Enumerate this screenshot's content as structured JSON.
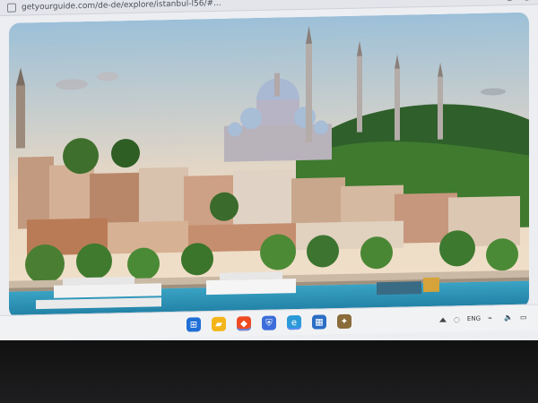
{
  "browser": {
    "url": "getyourguide.com/de-de/explore/istanbul-l56/#..."
  },
  "page": {
    "image_subject": "Istanbul skyline with Süleymaniye Mosque and Bosphorus ferries"
  },
  "taskbar": {
    "apps": [
      {
        "name": "windows-start-icon",
        "color": "#1f6fd6"
      },
      {
        "name": "file-explorer-icon",
        "color": "#f3b51a"
      },
      {
        "name": "brave-browser-icon",
        "color": "#f04a23"
      },
      {
        "name": "vpn-shield-icon",
        "color": "#3c6ddb"
      },
      {
        "name": "edge-icon",
        "color": "#2a9ad8"
      },
      {
        "name": "file-manager-icon",
        "color": "#2b6ec5"
      },
      {
        "name": "app-icon",
        "color": "#8a6b3a"
      }
    ],
    "tray": {
      "language": "ENG"
    }
  }
}
